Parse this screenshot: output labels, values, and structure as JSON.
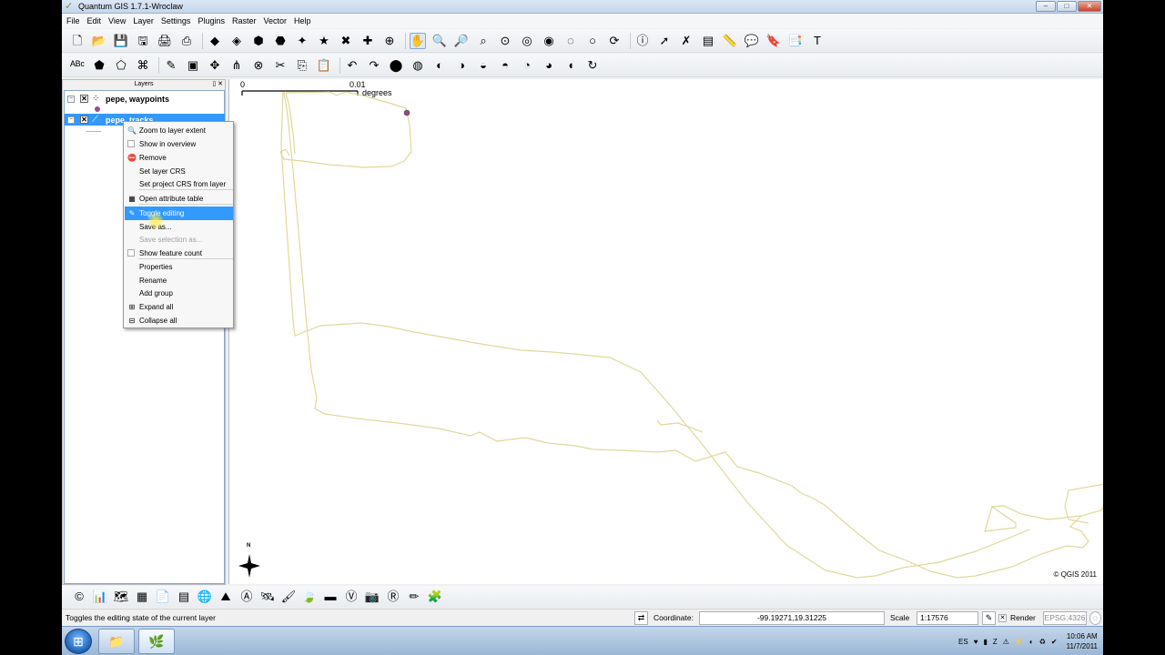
{
  "window": {
    "title": "Quantum GIS 1.7.1-Wroclaw",
    "buttons": [
      "–",
      "□",
      "✕"
    ]
  },
  "menu": [
    "File",
    "Edit",
    "View",
    "Layer",
    "Settings",
    "Plugins",
    "Raster",
    "Vector",
    "Help"
  ],
  "layers_panel": {
    "title": "Layers",
    "controls": "▯ ✕",
    "layers": [
      {
        "name": "pepe, waypoints",
        "checked": "✕",
        "toggle": "−",
        "symbol": "⁘"
      },
      {
        "name": "pepe, tracks",
        "checked": "✕",
        "toggle": "−",
        "symbol": "⟋"
      }
    ]
  },
  "context_menu": {
    "items": [
      {
        "label": "Zoom to layer extent",
        "icon": "magnifier-icon",
        "glyph": "🔍",
        "state": "normal"
      },
      {
        "label": "Show in overview",
        "icon": "checkbox-icon",
        "glyph": "",
        "state": "normal"
      },
      {
        "label": "Remove",
        "icon": "remove-icon",
        "glyph": "⛔",
        "state": "normal"
      },
      {
        "label": "Set layer CRS",
        "icon": "",
        "glyph": "",
        "state": "normal"
      },
      {
        "label": "Set project CRS from layer",
        "icon": "",
        "glyph": "",
        "state": "normal"
      },
      {
        "label": "Open attribute table",
        "icon": "table-icon",
        "glyph": "▦",
        "state": "normal"
      },
      {
        "label": "Toggle editing",
        "icon": "pencil-icon",
        "glyph": "✎",
        "state": "highlighted"
      },
      {
        "label": "Save as...",
        "icon": "",
        "glyph": "",
        "state": "normal"
      },
      {
        "label": "Save selection as...",
        "icon": "",
        "glyph": "",
        "state": "disabled"
      },
      {
        "label": "Show feature count",
        "icon": "checkbox-icon",
        "glyph": "",
        "state": "normal"
      },
      {
        "label": "Properties",
        "icon": "",
        "glyph": "",
        "state": "normal"
      },
      {
        "label": "Rename",
        "icon": "",
        "glyph": "",
        "state": "normal"
      },
      {
        "label": "Add group",
        "icon": "",
        "glyph": "",
        "state": "normal"
      },
      {
        "label": "Expand all",
        "icon": "expand-icon",
        "glyph": "⊞",
        "state": "normal"
      },
      {
        "label": "Collapse all",
        "icon": "collapse-icon",
        "glyph": "⊟",
        "state": "normal"
      }
    ]
  },
  "map": {
    "scale_bar": {
      "start": "0",
      "end": "0.01",
      "unit": "degrees"
    },
    "north_label": "N",
    "copyright": "© QGIS 2011",
    "track_color": "#e0d89a"
  },
  "toolbar1": [
    {
      "name": "new-project-icon",
      "glyph": "🗋"
    },
    {
      "name": "open-project-icon",
      "glyph": "📂"
    },
    {
      "name": "save-project-icon",
      "glyph": "💾"
    },
    {
      "name": "save-as-icon",
      "glyph": "🖫"
    },
    {
      "name": "print-composer-icon",
      "glyph": "🖨"
    },
    {
      "name": "print-icon",
      "glyph": "⎙"
    },
    {
      "name": "sep"
    },
    {
      "name": "add-vector-icon",
      "glyph": "◆"
    },
    {
      "name": "add-raster-icon",
      "glyph": "◈"
    },
    {
      "name": "add-postgis-icon",
      "glyph": "⬢"
    },
    {
      "name": "add-spatialite-icon",
      "glyph": "⬣"
    },
    {
      "name": "add-wms-icon",
      "glyph": "✦"
    },
    {
      "name": "new-layer-icon",
      "glyph": "★"
    },
    {
      "name": "remove-layer-icon",
      "glyph": "✖"
    },
    {
      "name": "add-wfs-icon",
      "glyph": "✚"
    },
    {
      "name": "add-gpx-icon",
      "glyph": "⊕"
    },
    {
      "name": "sep"
    },
    {
      "name": "pan-icon",
      "glyph": "✋",
      "active": true
    },
    {
      "name": "zoom-in-icon",
      "glyph": "🔍"
    },
    {
      "name": "zoom-out-icon",
      "glyph": "🔎"
    },
    {
      "name": "zoom-full-icon",
      "glyph": "⌕"
    },
    {
      "name": "zoom-selection-icon",
      "glyph": "⊙"
    },
    {
      "name": "zoom-layer-icon",
      "glyph": "◎"
    },
    {
      "name": "zoom-native-icon",
      "glyph": "◉"
    },
    {
      "name": "zoom-last-icon",
      "glyph": "◌"
    },
    {
      "name": "zoom-next-icon",
      "glyph": "○"
    },
    {
      "name": "refresh-icon",
      "glyph": "⟳"
    },
    {
      "name": "sep"
    },
    {
      "name": "identify-icon",
      "glyph": "ⓘ"
    },
    {
      "name": "select-icon",
      "glyph": "➚"
    },
    {
      "name": "deselect-icon",
      "glyph": "✗"
    },
    {
      "name": "attribute-table-icon",
      "glyph": "▤"
    },
    {
      "name": "measure-icon",
      "glyph": "📏"
    },
    {
      "name": "map-tips-icon",
      "glyph": "💬"
    },
    {
      "name": "new-bookmark-icon",
      "glyph": "🔖"
    },
    {
      "name": "show-bookmarks-icon",
      "glyph": "📑"
    },
    {
      "name": "text-annotation-icon",
      "glyph": "T"
    }
  ],
  "toolbar2": [
    {
      "name": "label-icon",
      "glyph": "ᴬᴮᶜ"
    },
    {
      "name": "digitize-icon",
      "glyph": "⬟"
    },
    {
      "name": "polygon-icon",
      "glyph": "⬠"
    },
    {
      "name": "node-tool-icon",
      "glyph": "⌘"
    },
    {
      "name": "sep"
    },
    {
      "name": "toggle-editing-icon",
      "glyph": "✎"
    },
    {
      "name": "save-edits-icon",
      "glyph": "▣"
    },
    {
      "name": "move-feature-icon",
      "glyph": "✥"
    },
    {
      "name": "vertex-icon",
      "glyph": "⋔"
    },
    {
      "name": "delete-selected-icon",
      "glyph": "⊗"
    },
    {
      "name": "cut-icon",
      "glyph": "✂"
    },
    {
      "name": "copy-icon",
      "glyph": "⎘"
    },
    {
      "name": "paste-icon",
      "glyph": "📋"
    },
    {
      "name": "sep"
    },
    {
      "name": "undo-icon",
      "glyph": "↶"
    },
    {
      "name": "redo-icon",
      "glyph": "↷"
    },
    {
      "name": "simplify-icon",
      "glyph": "⬤"
    },
    {
      "name": "add-ring-icon",
      "glyph": "◍"
    },
    {
      "name": "add-part-icon",
      "glyph": "◐"
    },
    {
      "name": "delete-ring-icon",
      "glyph": "◑"
    },
    {
      "name": "delete-part-icon",
      "glyph": "◒"
    },
    {
      "name": "reshape-icon",
      "glyph": "◓"
    },
    {
      "name": "offset-icon",
      "glyph": "◔"
    },
    {
      "name": "split-icon",
      "glyph": "◕"
    },
    {
      "name": "merge-icon",
      "glyph": "◖"
    },
    {
      "name": "rotate-icon",
      "glyph": "↻"
    }
  ],
  "toolbar3": [
    {
      "name": "copyright-icon",
      "glyph": "©"
    },
    {
      "name": "chart-icon",
      "glyph": "📊"
    },
    {
      "name": "georef-icon",
      "glyph": "🗺"
    },
    {
      "name": "grid-icon",
      "glyph": "▦"
    },
    {
      "name": "delimited-text-icon",
      "glyph": "📄"
    },
    {
      "name": "table-icon",
      "glyph": "▤"
    },
    {
      "name": "globe-icon",
      "glyph": "🌐"
    },
    {
      "name": "mountain-icon",
      "glyph": "⛰"
    },
    {
      "name": "north-arrow-icon",
      "glyph": "Ⓐ"
    },
    {
      "name": "gps-icon",
      "glyph": "🛰"
    },
    {
      "name": "brush-icon",
      "glyph": "🖌"
    },
    {
      "name": "leaf-icon",
      "glyph": "🍃"
    },
    {
      "name": "ruler-icon",
      "glyph": "▬"
    },
    {
      "name": "vector-icon",
      "glyph": "Ⓥ"
    },
    {
      "name": "screenshot-icon",
      "glyph": "📷"
    },
    {
      "name": "r-icon",
      "glyph": "Ⓡ"
    },
    {
      "name": "pen-icon",
      "glyph": "✏"
    },
    {
      "name": "plugin-icon",
      "glyph": "🧩"
    }
  ],
  "statusbar": {
    "message": "Toggles the editing state of the current layer",
    "coordinate_label": "Coordinate:",
    "coordinate_value": "-99.19271,19.31225",
    "scale_label": "Scale",
    "scale_value": "1:17576",
    "render_label": "Render",
    "render_check": "✕",
    "crs": "EPSG:4326"
  },
  "taskbar": {
    "start_glyph": "⊞",
    "buttons": [
      {
        "name": "explorer-taskbar-button",
        "glyph": "📁"
      },
      {
        "name": "qgis-taskbar-button",
        "glyph": "🌿",
        "active": true
      }
    ],
    "tray": {
      "lang": "ES",
      "icons": [
        "♥",
        "▮",
        "Z",
        "⚠",
        "⚡",
        "◐",
        "♻",
        "✔"
      ],
      "time": "10:06 AM",
      "date": "11/7/2011"
    }
  }
}
